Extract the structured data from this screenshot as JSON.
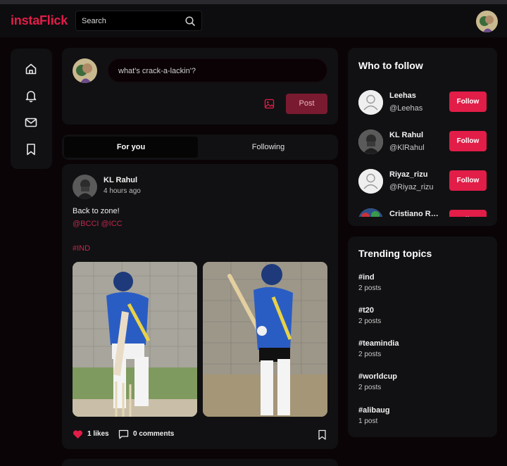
{
  "app": {
    "brand": "instaFlick"
  },
  "search": {
    "placeholder": "Search"
  },
  "composer": {
    "placeholder": "what's crack-a-lackin'?",
    "post_label": "Post"
  },
  "tabs": [
    {
      "label": "For you"
    },
    {
      "label": "Following"
    }
  ],
  "post": {
    "author": "KL Rahul",
    "time": "4 hours ago",
    "text": "Back to zone!",
    "mentions": "@BCCI @ICC",
    "hashtag": "#IND",
    "likes": "1 likes",
    "comments": "0 comments"
  },
  "who_to_follow": {
    "title": "Who to follow",
    "users": [
      {
        "name": "Leehas",
        "handle": "@Leehas",
        "button": "Follow"
      },
      {
        "name": "KL Rahul",
        "handle": "@KlRahul",
        "button": "Follow"
      },
      {
        "name": "Riyaz_rizu",
        "handle": "@Riyaz_rizu",
        "button": "Follow"
      },
      {
        "name": "Cristiano Ronaldo",
        "handle": "",
        "button": "Follow"
      }
    ]
  },
  "trending": {
    "title": "Trending topics",
    "topics": [
      {
        "tag": "#ind",
        "count": "2 posts"
      },
      {
        "tag": "#t20",
        "count": "2 posts"
      },
      {
        "tag": "#teamindia",
        "count": "2 posts"
      },
      {
        "tag": "#worldcup",
        "count": "2 posts"
      },
      {
        "tag": "#alibaug",
        "count": "1 post"
      }
    ]
  },
  "colors": {
    "accent": "#e11d48",
    "background": "#0a0406",
    "card": "#111113"
  },
  "icons": [
    "search-icon",
    "home-icon",
    "bell-icon",
    "mail-icon",
    "bookmark-icon",
    "image-icon",
    "heart-icon",
    "comment-icon"
  ]
}
